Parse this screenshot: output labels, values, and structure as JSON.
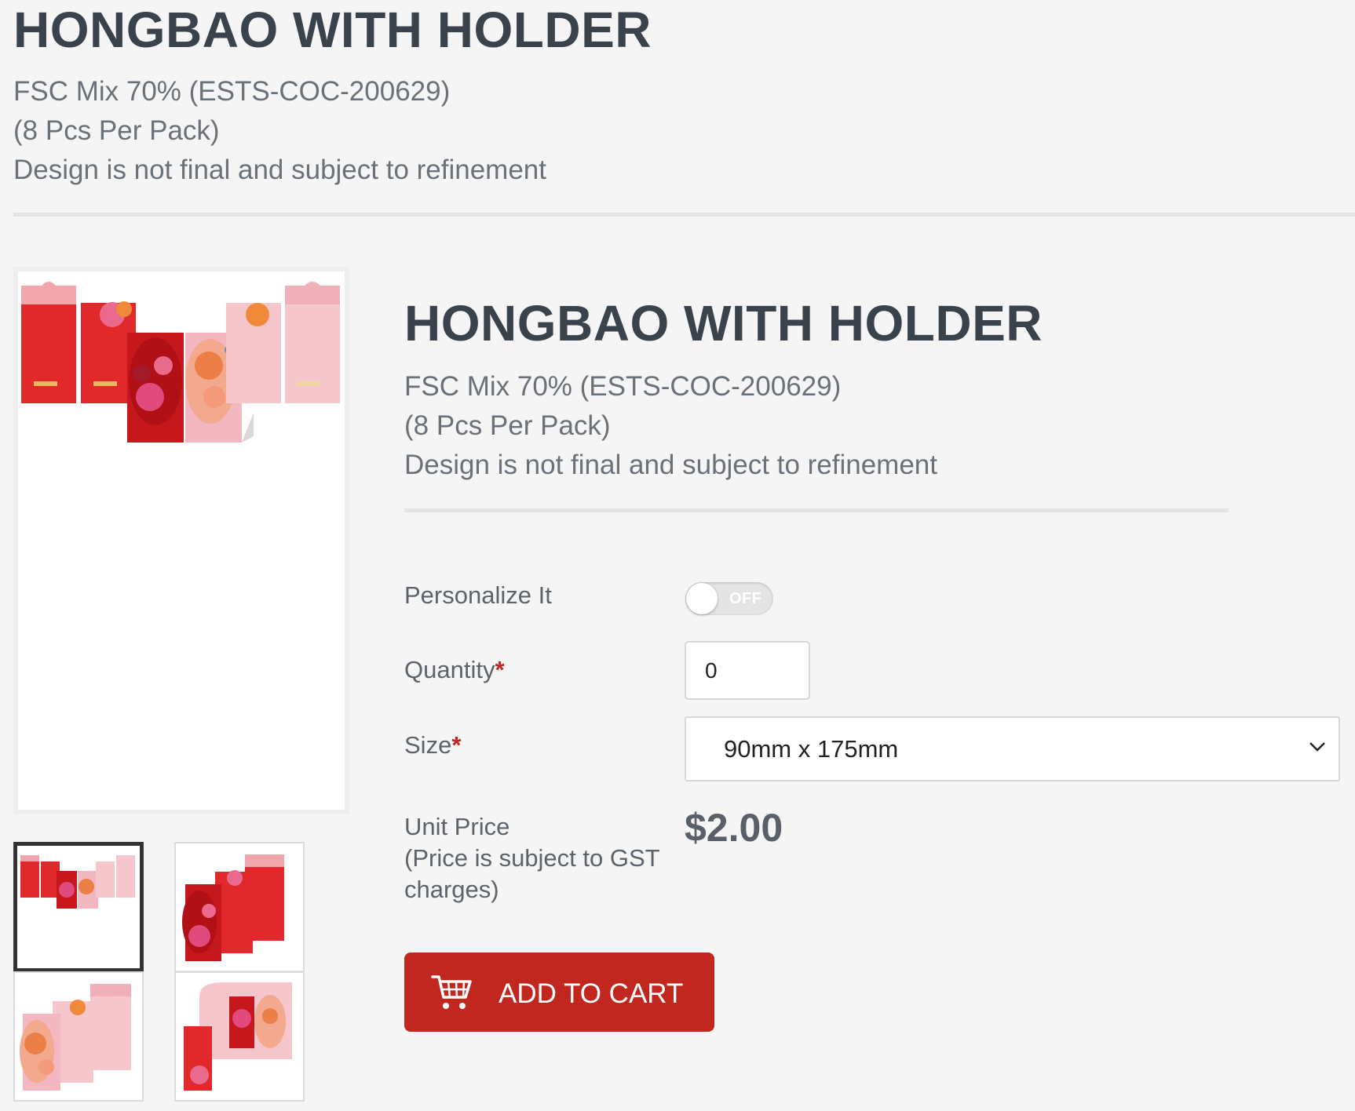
{
  "header": {
    "title": "HONGBAO WITH HOLDER",
    "desc_line1": "FSC Mix 70% (ESTS-COC-200629)",
    "desc_line2": "(8 Pcs Per Pack)",
    "desc_line3": "Design is not final and subject to refinement"
  },
  "gallery": {
    "main_image_alt": "Hongbao with holder product image",
    "thumbnails": [
      {
        "alt": "Hongbao set front view",
        "active": true
      },
      {
        "alt": "Red hongbao envelopes",
        "active": false
      },
      {
        "alt": "Pink hongbao envelopes",
        "active": false
      },
      {
        "alt": "Hongbao holder open view",
        "active": false
      }
    ]
  },
  "product": {
    "title": "HONGBAO WITH HOLDER",
    "desc_line1": "FSC Mix 70% (ESTS-COC-200629)",
    "desc_line2": "(8 Pcs Per Pack)",
    "desc_line3": "Design is not final and subject to refinement"
  },
  "form": {
    "personalize_label": "Personalize It",
    "personalize_state": "OFF",
    "quantity_label": "Quantity",
    "quantity_value": "0",
    "required_mark": "*",
    "size_label": "Size",
    "size_value": "90mm x 175mm",
    "unit_price_label_line1": "Unit Price",
    "unit_price_label_line2": "(Price is subject to GST",
    "unit_price_label_line3": "charges)",
    "price": "$2.00",
    "add_to_cart_label": "ADD TO CART"
  },
  "colors": {
    "accent": "#c1271f",
    "required": "#c0261e",
    "text_dark": "#3a424b",
    "text_muted": "#6b7178",
    "background": "#f5f5f5"
  },
  "icons": {
    "cart": "shopping-cart-icon",
    "chevron": "chevron-down-icon"
  }
}
